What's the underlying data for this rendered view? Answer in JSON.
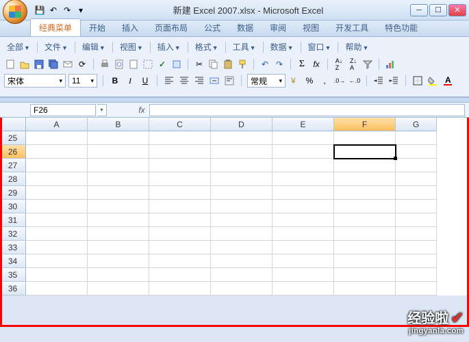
{
  "window": {
    "title": "新建 Excel 2007.xlsx - Microsoft Excel"
  },
  "qat": {
    "save": "💾",
    "undo": "↶",
    "redo": "↷",
    "refresh": "⟳"
  },
  "tabs": [
    {
      "label": "经典菜单",
      "active": true
    },
    {
      "label": "开始"
    },
    {
      "label": "插入"
    },
    {
      "label": "页面布局"
    },
    {
      "label": "公式"
    },
    {
      "label": "数据"
    },
    {
      "label": "审阅"
    },
    {
      "label": "视图"
    },
    {
      "label": "开发工具"
    },
    {
      "label": "特色功能"
    }
  ],
  "menu": {
    "all": "全部",
    "file": "文件",
    "edit": "编辑",
    "view": "视图",
    "insert": "插入",
    "format": "格式",
    "tools": "工具",
    "data": "数据",
    "window": "窗口",
    "help": "帮助"
  },
  "format_bar": {
    "font_name": "宋体",
    "font_size": "11",
    "style_label": "常规"
  },
  "namebox": {
    "value": "F26"
  },
  "columns": [
    "A",
    "B",
    "C",
    "D",
    "E",
    "F",
    "G"
  ],
  "rows": [
    "25",
    "26",
    "27",
    "28",
    "29",
    "30",
    "31",
    "32",
    "33",
    "34",
    "35",
    "36"
  ],
  "active": {
    "col": "F",
    "row": "26"
  },
  "watermark": {
    "big": "经验啦",
    "small": "jingyanla.com"
  }
}
